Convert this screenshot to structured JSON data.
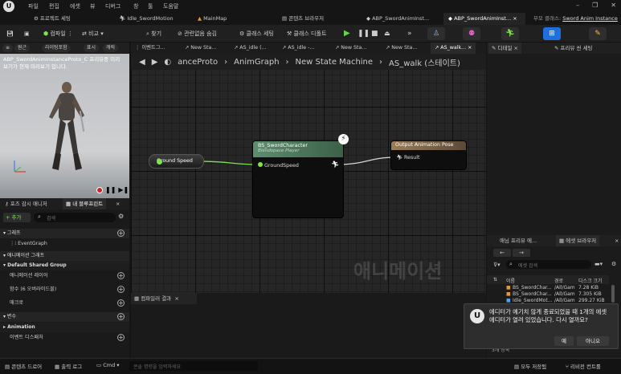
{
  "menu": [
    "파일",
    "편집",
    "에셋",
    "뷰",
    "디버그",
    "창",
    "툴",
    "도움말"
  ],
  "tabs": [
    {
      "label": "프로젝트 세팅"
    },
    {
      "label": "Idle_SwordMotion"
    },
    {
      "label": "MainMap"
    },
    {
      "label": "콘텐츠 브라우저"
    },
    {
      "label": "ABP_SwordAnimInst..."
    },
    {
      "label": "ABP_SwordAnimInst...",
      "active": true,
      "close": "×"
    }
  ],
  "parent_class": {
    "label": "부모 클래스:",
    "value": "Sword Anim Instance"
  },
  "toolbar": {
    "compile": "컴파일",
    "diff": "비교",
    "find": "찾기",
    "hide_unused": "관련없음 숨김",
    "class_settings": "클래스 세팅",
    "class_defaults": "클래스 디폴트"
  },
  "viewport": {
    "tabs": [
      "원근",
      "라이팅포함",
      "표시",
      "캐릭"
    ],
    "overlay": "ABP_SwordAnimInstanceProto_C 프리뷰중 미리 보기가 현재 미리보기 입니다."
  },
  "left_panel": {
    "tabs": [
      "포즈 감시 매니저",
      "내 블루프린트",
      "×"
    ],
    "add": "+ 추가",
    "search_placeholder": "검색",
    "sections": [
      {
        "type": "sec",
        "label": "그래프",
        "plus": true
      },
      {
        "type": "row",
        "label": "EventGraph"
      },
      {
        "type": "sec",
        "label": "애니메이션 그래프"
      },
      {
        "type": "sec",
        "label": "Default Shared Group"
      },
      {
        "type": "row",
        "label": "애니메이션 레이어",
        "plus": true
      },
      {
        "type": "row",
        "label": "함수 (6 오버라이드블)",
        "plus": true
      },
      {
        "type": "row",
        "label": "매크로",
        "plus": true
      },
      {
        "type": "sec",
        "label": "변수",
        "plus": true
      },
      {
        "type": "sec",
        "label": "Animation"
      },
      {
        "type": "row",
        "label": "이벤트 디스패처",
        "plus": true
      }
    ]
  },
  "graph": {
    "tabs": [
      "이벤트그...",
      "New Sta...",
      "AS_idle (...",
      "AS_idle -...",
      "New Sta...",
      "New Sta...",
      "AS_walk..."
    ],
    "breadcrumb": [
      "anceProto",
      "AnimGraph",
      "New State Machine",
      "AS_walk (스테이트)"
    ],
    "watermark": "애니메이션",
    "nodes": {
      "ground_speed": "Ground Speed",
      "blendspace_title": "BS_SwordCharacter",
      "blendspace_sub": "Blendspace Player",
      "blendspace_pin": "GroundSpeed",
      "output_title": "Output Animation Pose",
      "output_pin": "Result"
    }
  },
  "compiler": {
    "tab": "컴파일러 결과",
    "close": "×"
  },
  "details": {
    "tab": "디테일",
    "close": "×",
    "preview_tab": "프리뷰 씬 세팅"
  },
  "assets": {
    "tabs": [
      "애님 프리뷰 에...",
      "에셋 브라우저",
      "×"
    ],
    "search_placeholder": "에셋 검색",
    "columns": [
      "이름",
      "경로",
      "디스크 크기"
    ],
    "rows": [
      {
        "name": "BS_SwordChar...",
        "path": "/All/Gam",
        "size": "7.28 KiB"
      },
      {
        "name": "BS_SwordChar...",
        "path": "/All/Gam",
        "size": "7.305 KiB"
      },
      {
        "name": "Idle_SwordMot...",
        "path": "/All/Gam",
        "size": "299.27 KiB"
      }
    ],
    "count": "3개 항목"
  },
  "notification": {
    "text": "에디터가 예기치 않게 종료되었을 때 1개의 에셋 에디터가 열려 있었습니다. 다시 열까요?",
    "yes": "예",
    "no": "아니오"
  },
  "statusbar": {
    "drawer": "콘텐츠 드로어",
    "output": "출력 로그",
    "cmd": "Cmd",
    "cmd_placeholder": "콘솔 명령을 입력하세요",
    "save_all": "모두 저장됨",
    "revision": "리비전 컨트롤"
  }
}
